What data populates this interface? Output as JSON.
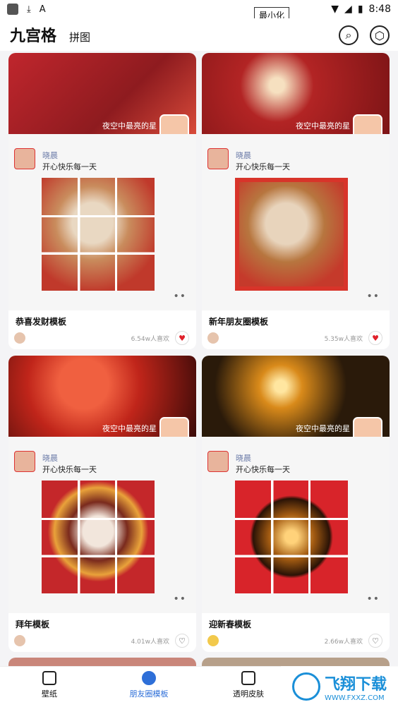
{
  "status": {
    "time": "8:48"
  },
  "minimize": "最小化",
  "header": {
    "title": "九宫格",
    "tab": "拼图"
  },
  "cards": [
    {
      "banner_text": "夜空中最亮的星",
      "user": "晓晨",
      "msg": "开心快乐每一天",
      "title": "恭喜发财模板",
      "likes": "6.54w人喜欢",
      "liked": true
    },
    {
      "banner_text": "夜空中最亮的星",
      "user": "晓晨",
      "msg": "开心快乐每一天",
      "title": "新年朋友圈模板",
      "likes": "5.35w人喜欢",
      "liked": true
    },
    {
      "banner_text": "夜空中最亮的星",
      "user": "晓晨",
      "msg": "开心快乐每一天",
      "title": "拜年模板",
      "likes": "4.01w人喜欢",
      "liked": false
    },
    {
      "banner_text": "夜空中最亮的星",
      "user": "晓晨",
      "msg": "开心快乐每一天",
      "title": "迎新春模板",
      "likes": "2.66w人喜欢",
      "liked": false
    }
  ],
  "nav": {
    "items": [
      "壁纸",
      "朋友圈模板",
      "透明皮肤"
    ],
    "active": 1
  },
  "watermark": {
    "text": "飞翔下载",
    "sub": "WWW.FXXZ.COM"
  }
}
